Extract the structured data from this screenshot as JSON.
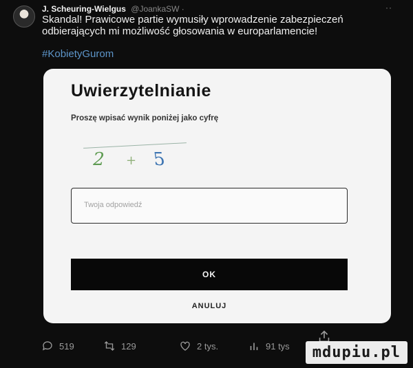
{
  "tweet": {
    "author_name": "J. Scheuring-Wielgus",
    "author_handle": "@JoankaSW ·",
    "more": "··",
    "text": "Skandal! Prawicowe partie wymusiły wprowadzenie zabezpieczeń odbierających mi możliwość głosowania w europarlamencie!",
    "hashtag": "#KobietyGurom"
  },
  "dialog": {
    "title": "Uwierzytelnianie",
    "instruction": "Proszę wpisać wynik poniżej jako cyfrę",
    "captcha": [
      "2",
      "+",
      "5"
    ],
    "input_placeholder": "Twoja odpowiedź",
    "input_value": "",
    "ok_label": "OK",
    "cancel_label": "ANULUJ"
  },
  "actions": {
    "replies": "519",
    "retweets": "129",
    "likes": "2 tys.",
    "views": "91 tys"
  },
  "watermark": "mdupiu.pl",
  "colors": {
    "background": "#0d0d0d",
    "card": "#f4f4f4",
    "hashtag": "#5d95c9",
    "ok_button": "#080808"
  }
}
